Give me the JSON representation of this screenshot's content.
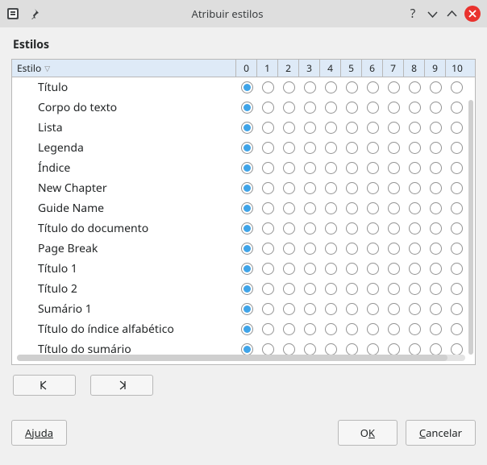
{
  "window": {
    "title": "Atribuir estilos"
  },
  "section": {
    "title": "Estilos"
  },
  "grid": {
    "style_header": "Estilo",
    "levels": [
      "0",
      "1",
      "2",
      "3",
      "4",
      "5",
      "6",
      "7",
      "8",
      "9",
      "10"
    ],
    "rows": [
      {
        "label": "Título",
        "selected": 0
      },
      {
        "label": "Corpo do texto",
        "selected": 0
      },
      {
        "label": "Lista",
        "selected": 0
      },
      {
        "label": "Legenda",
        "selected": 0
      },
      {
        "label": "Índice",
        "selected": 0
      },
      {
        "label": "New Chapter",
        "selected": 0
      },
      {
        "label": "Guide Name",
        "selected": 0
      },
      {
        "label": "Título do documento",
        "selected": 0
      },
      {
        "label": "Page Break",
        "selected": 0
      },
      {
        "label": "Título 1",
        "selected": 0
      },
      {
        "label": "Título 2",
        "selected": 0
      },
      {
        "label": "Sumário 1",
        "selected": 0
      },
      {
        "label": "Título do índice alfabético",
        "selected": 0
      },
      {
        "label": "Título do sumário",
        "selected": 0
      }
    ]
  },
  "buttons": {
    "help": "Ajuda",
    "ok_pre": "O",
    "ok_ul": "K",
    "cancel_ul": "C",
    "cancel_rest": "ancelar"
  }
}
